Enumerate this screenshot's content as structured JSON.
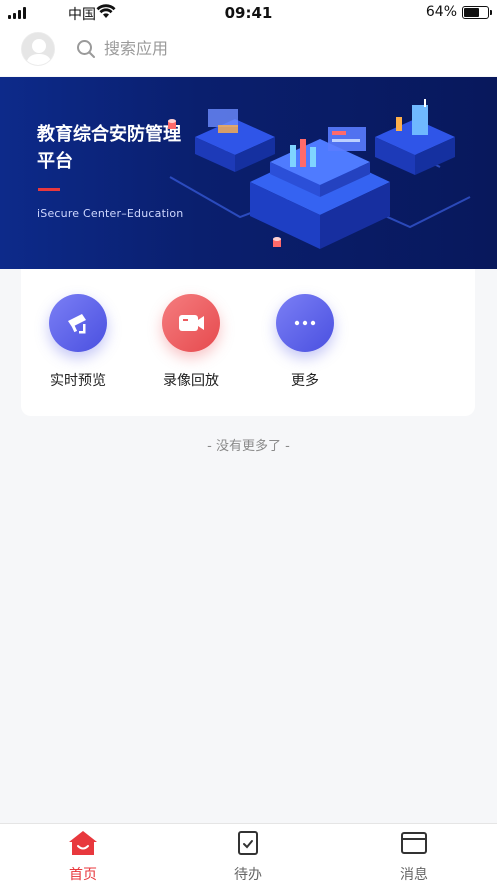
{
  "status_bar": {
    "carrier": "中国",
    "time": "09:41",
    "battery": "64%"
  },
  "header": {
    "search_placeholder": "搜索应用"
  },
  "banner": {
    "title": "教育综合安防管理平台",
    "subtitle": "iSecure Center–Education"
  },
  "apps": [
    {
      "label": "实时预览",
      "icon": "camera-icon",
      "color": "#5a5fe6"
    },
    {
      "label": "录像回放",
      "icon": "video-icon",
      "color": "#ec5a5e"
    },
    {
      "label": "更多",
      "icon": "more-icon",
      "color": "#5a5fe6"
    }
  ],
  "list_footer": "- 没有更多了 -",
  "tabs": [
    {
      "label": "首页",
      "icon": "home-icon",
      "active": true
    },
    {
      "label": "待办",
      "icon": "todo-icon",
      "active": false
    },
    {
      "label": "消息",
      "icon": "message-icon",
      "active": false
    }
  ],
  "colors": {
    "accent": "#e8383d",
    "banner_bg": "#0d2a8a",
    "app_purple": "#5a5fe6",
    "app_red": "#ec5a5e"
  }
}
